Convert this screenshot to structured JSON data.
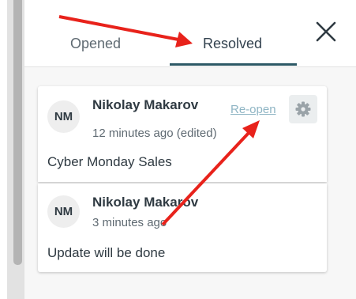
{
  "tabs": [
    {
      "label": "Opened",
      "active": false
    },
    {
      "label": "Resolved",
      "active": true
    }
  ],
  "accent_color": "#2d5966",
  "annotation_color": "#e8221b",
  "comments": [
    {
      "avatar_initials": "NM",
      "author": "Nikolay Makarov",
      "time": "12 minutes ago (edited)",
      "message": "Cyber Monday Sales",
      "action_label": "Re-open",
      "settings_icon": "gear-icon"
    },
    {
      "avatar_initials": "NM",
      "author": "Nikolay Makarov",
      "time": "3 minutes ago",
      "message": "Update will be done"
    }
  ]
}
